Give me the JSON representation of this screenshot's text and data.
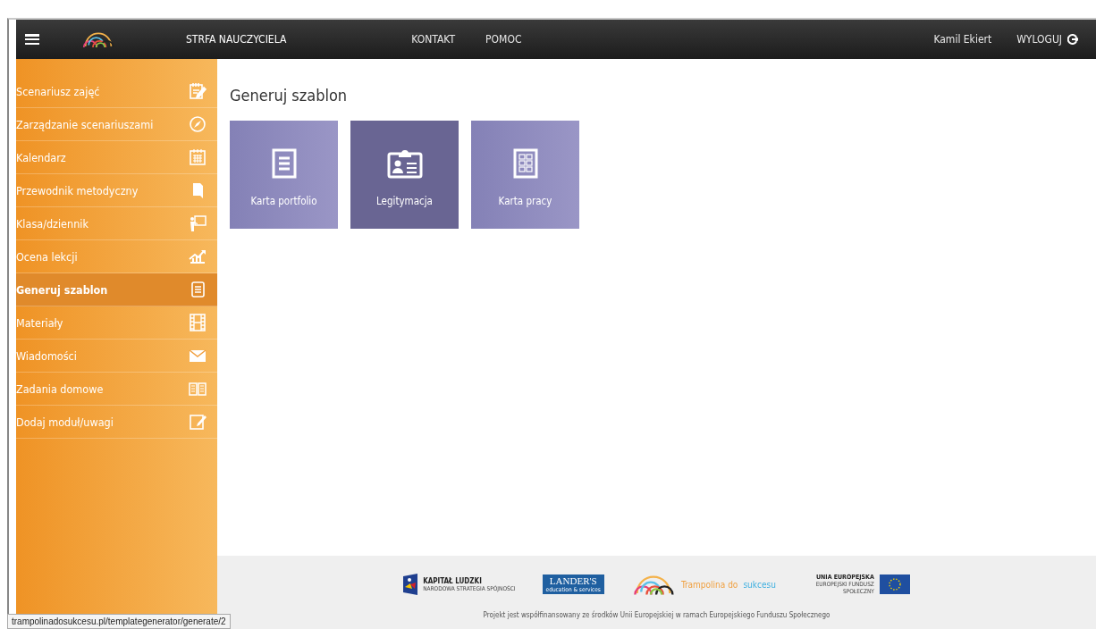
{
  "header": {
    "nav": [
      {
        "label": "STRFA NAUCZYCIELA",
        "kind": "section"
      },
      {
        "label": "KONTAKT",
        "kind": "link"
      },
      {
        "label": "POMOC",
        "kind": "link"
      }
    ],
    "user": "Kamil Ekiert",
    "logout": "WYLOGUJ"
  },
  "sidebar": {
    "items": [
      {
        "label": "Scenariusz zajęć",
        "kind": "notepad",
        "selected": false
      },
      {
        "label": "Zarządzanie scenariuszami",
        "kind": "compass",
        "selected": false
      },
      {
        "label": "Kalendarz",
        "kind": "calendar",
        "selected": false
      },
      {
        "label": "Przewodnik metodyczny",
        "kind": "book",
        "selected": false
      },
      {
        "label": "Klasa/dziennik",
        "kind": "board",
        "selected": false
      },
      {
        "label": "Ocena lekcji",
        "kind": "chart",
        "selected": false
      },
      {
        "label": "Generuj szablon",
        "kind": "document",
        "selected": true
      },
      {
        "label": "Materiały",
        "kind": "film",
        "selected": false
      },
      {
        "label": "Wiadomości",
        "kind": "envelope",
        "selected": false
      },
      {
        "label": "Zadania domowe",
        "kind": "openbook",
        "selected": false
      },
      {
        "label": "Dodaj moduł/uwagi",
        "kind": "clipboard",
        "selected": false
      }
    ]
  },
  "main": {
    "title": "Generuj szablon",
    "tiles": [
      {
        "label": "Karta portfolio",
        "kind": "document",
        "highlighted": false
      },
      {
        "label": "Legitymacja",
        "kind": "badge",
        "highlighted": true
      },
      {
        "label": "Karta pracy",
        "kind": "checklist",
        "highlighted": false
      }
    ]
  },
  "footer": {
    "logos": [
      {
        "kind": "kapital",
        "title": "KAPITAŁ LUDZKI",
        "subtitle": "NARODOWA STRATEGIA SPÓJNOŚCI"
      },
      {
        "kind": "landers",
        "title": "LANDER'S",
        "subtitle": "education & services"
      },
      {
        "kind": "trampolina",
        "title": "Trampolina do",
        "subtitle": "sukcesu"
      },
      {
        "kind": "eu",
        "title": "UNIA EUROPEJSKA",
        "subtitle": "EUROPEJSKI FUNDUSZ SPOŁECZNY"
      }
    ],
    "note": "Projekt jest współfinansowany ze środków Unii Europejskiej w ramach Europejskiego Funduszu Społecznego"
  },
  "status_bar": "trampolinadosukcesu.pl/templategenerator/generate/2"
}
